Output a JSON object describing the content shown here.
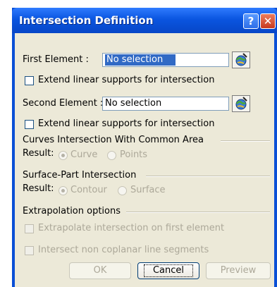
{
  "dialog": {
    "title": "Intersection Definition",
    "help_glyph": "?",
    "close_glyph": "✕"
  },
  "first": {
    "label": "First Element :",
    "value": "No selection",
    "extend_label": "Extend linear supports for intersection"
  },
  "second": {
    "label": "Second Element :",
    "value": "No selection",
    "extend_label": "Extend linear supports for intersection"
  },
  "curves": {
    "group_label": "Curves Intersection With Common Area",
    "result_label": "Result:",
    "options": [
      "Curve",
      "Points"
    ],
    "selected": "Curve"
  },
  "surface": {
    "group_label": "Surface-Part Intersection",
    "result_label": "Result:",
    "options": [
      "Contour",
      "Surface"
    ],
    "selected": "Contour"
  },
  "extrapolation": {
    "group_label": "Extrapolation options",
    "opt1": "Extrapolate intersection on first element",
    "opt2": "Intersect non coplanar line segments"
  },
  "buttons": {
    "ok": "OK",
    "cancel": "Cancel",
    "preview": "Preview"
  },
  "colors": {
    "title_bar": "#0a55e0",
    "dialog_bg": "#ece9d8",
    "selection": "#316ac5",
    "disabled_text": "#aca899"
  },
  "icons": [
    "help-icon",
    "close-icon",
    "element-picker-icon"
  ]
}
